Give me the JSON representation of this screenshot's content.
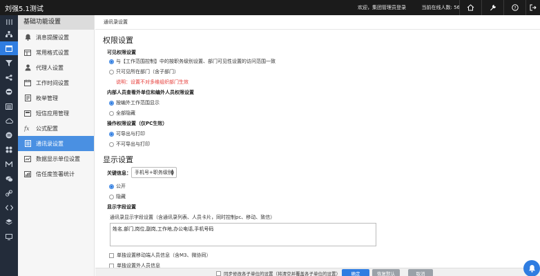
{
  "app": {
    "title": "刘强5.1测试",
    "welcome": "欢迎，集团管理员登录",
    "online": "当前在线人数: 56",
    "icons": [
      "home-icon",
      "wrench-icon",
      "help-icon",
      "logout-icon"
    ]
  },
  "rail": {
    "items": [
      "grid-icon",
      "org-icon",
      "settings-window-icon",
      "funnel-icon",
      "node-icon",
      "stop-icon",
      "list-icon",
      "cloud-icon",
      "grid-dots-icon",
      "apps-icon",
      "m-icon",
      "chat-icon",
      "link-icon",
      "code-icon",
      "layers-icon",
      "monitor-icon"
    ],
    "active_index": 2
  },
  "sidebar": {
    "title": "基础功能设置",
    "items": [
      {
        "label": "消息提醒设置",
        "icon": "bell-icon"
      },
      {
        "label": "常用格式设置",
        "icon": "table-icon"
      },
      {
        "label": "代理人设置",
        "icon": "user-icon"
      },
      {
        "label": "工作时间设置",
        "icon": "clock-icon"
      },
      {
        "label": "枚举管理",
        "icon": "doc-icon"
      },
      {
        "label": "短信应用管理",
        "icon": "sms-icon"
      },
      {
        "label": "公式配置",
        "icon": "fx-icon"
      },
      {
        "label": "通讯录设置",
        "icon": "contacts-icon"
      },
      {
        "label": "数据显示单位设置",
        "icon": "data-icon"
      },
      {
        "label": "信任度签署统计",
        "icon": "stats-icon"
      }
    ],
    "active_index": 7
  },
  "breadcrumb": "通讯录设置",
  "permission": {
    "title": "权限设置",
    "visible": {
      "title": "可见权限设置",
      "opt1": "与【工作范围控制】中的按职务级别设置、部门可见性设置的访问范围一致",
      "opt2": "只可见所在部门（含子部门）",
      "note": "说明：设置不对多维组织部门生效"
    },
    "inner": {
      "title": "内部人员查看外单位和编外人员权限设置",
      "opt1": "按编外工作范围显示",
      "opt2": "全部隐藏"
    },
    "operate": {
      "title": "操作权限设置（仅PC生效）",
      "opt1": "可导出与打印",
      "opt2": "不可导出与打印"
    }
  },
  "display": {
    "title": "显示设置",
    "key_info_label": "关键信息：",
    "key_info_value": "手机号+职务级别",
    "opt1": "公开",
    "opt2": "隐藏",
    "fields_title": "显示字段设置",
    "fields_desc": "通讯录显示字段设置（含通讯录列表、人员卡片，同时控制pc、移动、致信）",
    "fields_value": "姓名,部门,岗位,副岗,工作地,办公电话,手机号码",
    "mobile_check": "单独设置移动端人员信息（含M3、微协同）",
    "partial_text": "单独设置外人员信息"
  },
  "footer": {
    "sync_label": "同步修改各子单位的设置（将清空并覆盖各子单位的设置）",
    "ok": "确定",
    "reset": "恢复默认",
    "cancel": "取消"
  }
}
